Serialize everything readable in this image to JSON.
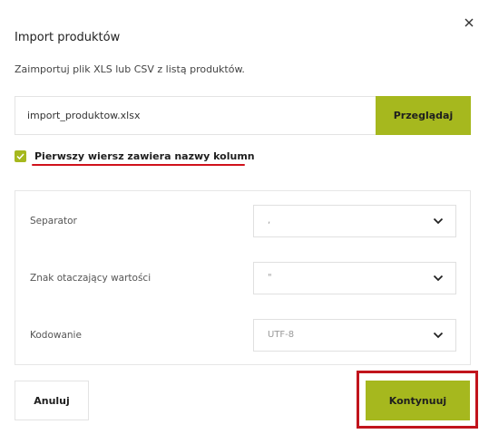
{
  "dialog": {
    "title": "Import produktów",
    "subtitle": "Zaimportuj plik XLS lub CSV z listą produktów.",
    "close_icon": "close-icon"
  },
  "file": {
    "value": "import_produktow.xlsx",
    "browse_label": "Przeglądaj"
  },
  "header_option": {
    "checked": true,
    "label": "Pierwszy wiersz zawiera nazwy kolumn"
  },
  "settings": [
    {
      "label": "Separator",
      "value": ","
    },
    {
      "label": "Znak otaczający wartości",
      "value": "\""
    },
    {
      "label": "Kodowanie",
      "value": "UTF-8"
    }
  ],
  "actions": {
    "cancel_label": "Anuluj",
    "continue_label": "Kontynuuj"
  },
  "colors": {
    "accent": "#a6b81e",
    "highlight": "#c1141c"
  }
}
